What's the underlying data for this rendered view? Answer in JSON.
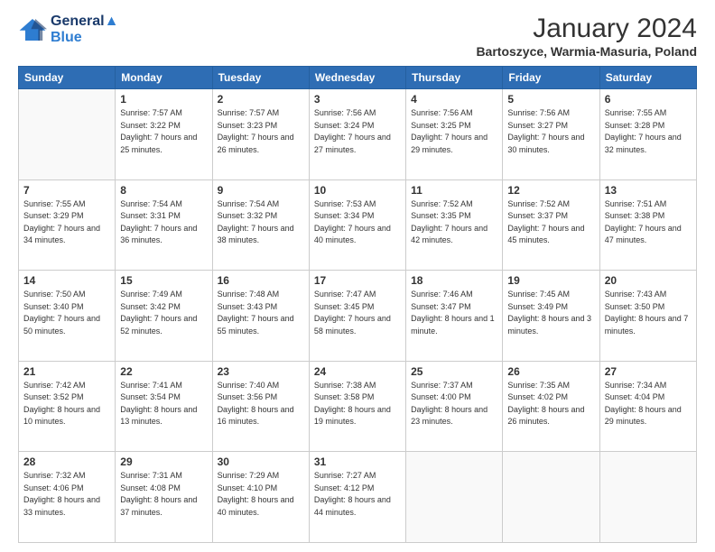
{
  "header": {
    "logo_line1": "General",
    "logo_line2": "Blue",
    "title": "January 2024",
    "location": "Bartoszyce, Warmia-Masuria, Poland"
  },
  "weekdays": [
    "Sunday",
    "Monday",
    "Tuesday",
    "Wednesday",
    "Thursday",
    "Friday",
    "Saturday"
  ],
  "weeks": [
    [
      {
        "day": "",
        "sunrise": "",
        "sunset": "",
        "daylight": ""
      },
      {
        "day": "1",
        "sunrise": "Sunrise: 7:57 AM",
        "sunset": "Sunset: 3:22 PM",
        "daylight": "Daylight: 7 hours and 25 minutes."
      },
      {
        "day": "2",
        "sunrise": "Sunrise: 7:57 AM",
        "sunset": "Sunset: 3:23 PM",
        "daylight": "Daylight: 7 hours and 26 minutes."
      },
      {
        "day": "3",
        "sunrise": "Sunrise: 7:56 AM",
        "sunset": "Sunset: 3:24 PM",
        "daylight": "Daylight: 7 hours and 27 minutes."
      },
      {
        "day": "4",
        "sunrise": "Sunrise: 7:56 AM",
        "sunset": "Sunset: 3:25 PM",
        "daylight": "Daylight: 7 hours and 29 minutes."
      },
      {
        "day": "5",
        "sunrise": "Sunrise: 7:56 AM",
        "sunset": "Sunset: 3:27 PM",
        "daylight": "Daylight: 7 hours and 30 minutes."
      },
      {
        "day": "6",
        "sunrise": "Sunrise: 7:55 AM",
        "sunset": "Sunset: 3:28 PM",
        "daylight": "Daylight: 7 hours and 32 minutes."
      }
    ],
    [
      {
        "day": "7",
        "sunrise": "Sunrise: 7:55 AM",
        "sunset": "Sunset: 3:29 PM",
        "daylight": "Daylight: 7 hours and 34 minutes."
      },
      {
        "day": "8",
        "sunrise": "Sunrise: 7:54 AM",
        "sunset": "Sunset: 3:31 PM",
        "daylight": "Daylight: 7 hours and 36 minutes."
      },
      {
        "day": "9",
        "sunrise": "Sunrise: 7:54 AM",
        "sunset": "Sunset: 3:32 PM",
        "daylight": "Daylight: 7 hours and 38 minutes."
      },
      {
        "day": "10",
        "sunrise": "Sunrise: 7:53 AM",
        "sunset": "Sunset: 3:34 PM",
        "daylight": "Daylight: 7 hours and 40 minutes."
      },
      {
        "day": "11",
        "sunrise": "Sunrise: 7:52 AM",
        "sunset": "Sunset: 3:35 PM",
        "daylight": "Daylight: 7 hours and 42 minutes."
      },
      {
        "day": "12",
        "sunrise": "Sunrise: 7:52 AM",
        "sunset": "Sunset: 3:37 PM",
        "daylight": "Daylight: 7 hours and 45 minutes."
      },
      {
        "day": "13",
        "sunrise": "Sunrise: 7:51 AM",
        "sunset": "Sunset: 3:38 PM",
        "daylight": "Daylight: 7 hours and 47 minutes."
      }
    ],
    [
      {
        "day": "14",
        "sunrise": "Sunrise: 7:50 AM",
        "sunset": "Sunset: 3:40 PM",
        "daylight": "Daylight: 7 hours and 50 minutes."
      },
      {
        "day": "15",
        "sunrise": "Sunrise: 7:49 AM",
        "sunset": "Sunset: 3:42 PM",
        "daylight": "Daylight: 7 hours and 52 minutes."
      },
      {
        "day": "16",
        "sunrise": "Sunrise: 7:48 AM",
        "sunset": "Sunset: 3:43 PM",
        "daylight": "Daylight: 7 hours and 55 minutes."
      },
      {
        "day": "17",
        "sunrise": "Sunrise: 7:47 AM",
        "sunset": "Sunset: 3:45 PM",
        "daylight": "Daylight: 7 hours and 58 minutes."
      },
      {
        "day": "18",
        "sunrise": "Sunrise: 7:46 AM",
        "sunset": "Sunset: 3:47 PM",
        "daylight": "Daylight: 8 hours and 1 minute."
      },
      {
        "day": "19",
        "sunrise": "Sunrise: 7:45 AM",
        "sunset": "Sunset: 3:49 PM",
        "daylight": "Daylight: 8 hours and 3 minutes."
      },
      {
        "day": "20",
        "sunrise": "Sunrise: 7:43 AM",
        "sunset": "Sunset: 3:50 PM",
        "daylight": "Daylight: 8 hours and 7 minutes."
      }
    ],
    [
      {
        "day": "21",
        "sunrise": "Sunrise: 7:42 AM",
        "sunset": "Sunset: 3:52 PM",
        "daylight": "Daylight: 8 hours and 10 minutes."
      },
      {
        "day": "22",
        "sunrise": "Sunrise: 7:41 AM",
        "sunset": "Sunset: 3:54 PM",
        "daylight": "Daylight: 8 hours and 13 minutes."
      },
      {
        "day": "23",
        "sunrise": "Sunrise: 7:40 AM",
        "sunset": "Sunset: 3:56 PM",
        "daylight": "Daylight: 8 hours and 16 minutes."
      },
      {
        "day": "24",
        "sunrise": "Sunrise: 7:38 AM",
        "sunset": "Sunset: 3:58 PM",
        "daylight": "Daylight: 8 hours and 19 minutes."
      },
      {
        "day": "25",
        "sunrise": "Sunrise: 7:37 AM",
        "sunset": "Sunset: 4:00 PM",
        "daylight": "Daylight: 8 hours and 23 minutes."
      },
      {
        "day": "26",
        "sunrise": "Sunrise: 7:35 AM",
        "sunset": "Sunset: 4:02 PM",
        "daylight": "Daylight: 8 hours and 26 minutes."
      },
      {
        "day": "27",
        "sunrise": "Sunrise: 7:34 AM",
        "sunset": "Sunset: 4:04 PM",
        "daylight": "Daylight: 8 hours and 29 minutes."
      }
    ],
    [
      {
        "day": "28",
        "sunrise": "Sunrise: 7:32 AM",
        "sunset": "Sunset: 4:06 PM",
        "daylight": "Daylight: 8 hours and 33 minutes."
      },
      {
        "day": "29",
        "sunrise": "Sunrise: 7:31 AM",
        "sunset": "Sunset: 4:08 PM",
        "daylight": "Daylight: 8 hours and 37 minutes."
      },
      {
        "day": "30",
        "sunrise": "Sunrise: 7:29 AM",
        "sunset": "Sunset: 4:10 PM",
        "daylight": "Daylight: 8 hours and 40 minutes."
      },
      {
        "day": "31",
        "sunrise": "Sunrise: 7:27 AM",
        "sunset": "Sunset: 4:12 PM",
        "daylight": "Daylight: 8 hours and 44 minutes."
      },
      {
        "day": "",
        "sunrise": "",
        "sunset": "",
        "daylight": ""
      },
      {
        "day": "",
        "sunrise": "",
        "sunset": "",
        "daylight": ""
      },
      {
        "day": "",
        "sunrise": "",
        "sunset": "",
        "daylight": ""
      }
    ]
  ]
}
